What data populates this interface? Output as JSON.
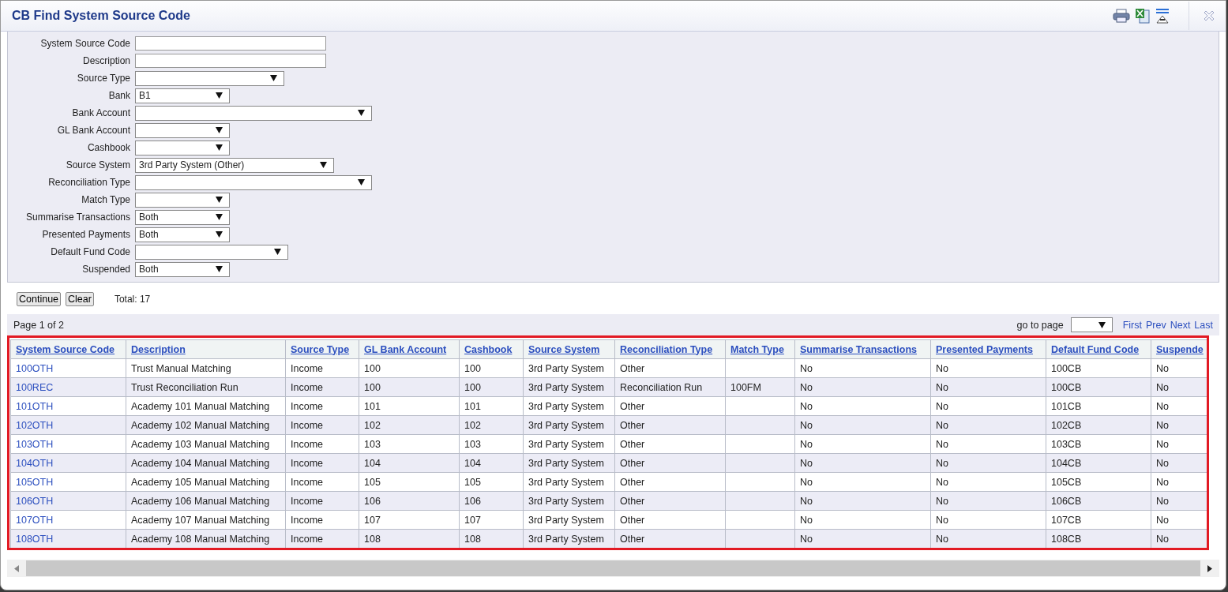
{
  "window": {
    "title": "CB Find System Source Code"
  },
  "filters": [
    {
      "label": "System Source Code",
      "kind": "text"
    },
    {
      "label": "Description",
      "kind": "text"
    },
    {
      "label": "Source Type",
      "kind": "select"
    },
    {
      "label": "Bank",
      "kind": "select",
      "value": "B1"
    },
    {
      "label": "Bank Account",
      "kind": "select"
    },
    {
      "label": "GL Bank Account",
      "kind": "select"
    },
    {
      "label": "Cashbook",
      "kind": "select"
    },
    {
      "label": "Source System",
      "kind": "select",
      "value": "3rd Party System (Other)"
    },
    {
      "label": "Reconciliation Type",
      "kind": "select"
    },
    {
      "label": "Match Type",
      "kind": "select"
    },
    {
      "label": "Summarise Transactions",
      "kind": "select",
      "value": "Both"
    },
    {
      "label": "Presented Payments",
      "kind": "select",
      "value": "Both"
    },
    {
      "label": "Default Fund Code",
      "kind": "select"
    },
    {
      "label": "Suspended",
      "kind": "select",
      "value": "Both"
    }
  ],
  "buttons": [
    "Continue",
    "Clear"
  ],
  "total": "Total: 17",
  "pager": {
    "page": "Page 1 of 2",
    "goto_label": "go to page",
    "links": [
      "First",
      "Prev",
      "Next",
      "Last"
    ]
  },
  "table": {
    "columns": [
      "System Source Code",
      "Description",
      "Source Type",
      "GL Bank Account",
      "Cashbook",
      "Source System",
      "Reconciliation Type",
      "Match Type",
      "Summarise Transactions",
      "Presented Payments",
      "Default Fund Code",
      "Suspende"
    ],
    "rows": [
      [
        "100OTH",
        "Trust Manual Matching",
        "Income",
        "100",
        "100",
        "3rd Party System",
        "Other",
        "",
        "No",
        "No",
        "100CB",
        "No"
      ],
      [
        "100REC",
        "Trust Reconciliation Run",
        "Income",
        "100",
        "100",
        "3rd Party System",
        "Reconciliation Run",
        "100FM",
        "No",
        "No",
        "100CB",
        "No"
      ],
      [
        "101OTH",
        "Academy 101 Manual Matching",
        "Income",
        "101",
        "101",
        "3rd Party System",
        "Other",
        "",
        "No",
        "No",
        "101CB",
        "No"
      ],
      [
        "102OTH",
        "Academy 102 Manual Matching",
        "Income",
        "102",
        "102",
        "3rd Party System",
        "Other",
        "",
        "No",
        "No",
        "102CB",
        "No"
      ],
      [
        "103OTH",
        "Academy 103 Manual Matching",
        "Income",
        "103",
        "103",
        "3rd Party System",
        "Other",
        "",
        "No",
        "No",
        "103CB",
        "No"
      ],
      [
        "104OTH",
        "Academy 104 Manual Matching",
        "Income",
        "104",
        "104",
        "3rd Party System",
        "Other",
        "",
        "No",
        "No",
        "104CB",
        "No"
      ],
      [
        "105OTH",
        "Academy 105 Manual Matching",
        "Income",
        "105",
        "105",
        "3rd Party System",
        "Other",
        "",
        "No",
        "No",
        "105CB",
        "No"
      ],
      [
        "106OTH",
        "Academy 106 Manual Matching",
        "Income",
        "106",
        "106",
        "3rd Party System",
        "Other",
        "",
        "No",
        "No",
        "106CB",
        "No"
      ],
      [
        "107OTH",
        "Academy 107 Manual Matching",
        "Income",
        "107",
        "107",
        "3rd Party System",
        "Other",
        "",
        "No",
        "No",
        "107CB",
        "No"
      ],
      [
        "108OTH",
        "Academy 108 Manual Matching",
        "Income",
        "108",
        "108",
        "3rd Party System",
        "Other",
        "",
        "No",
        "No",
        "108CB",
        "No"
      ]
    ]
  }
}
